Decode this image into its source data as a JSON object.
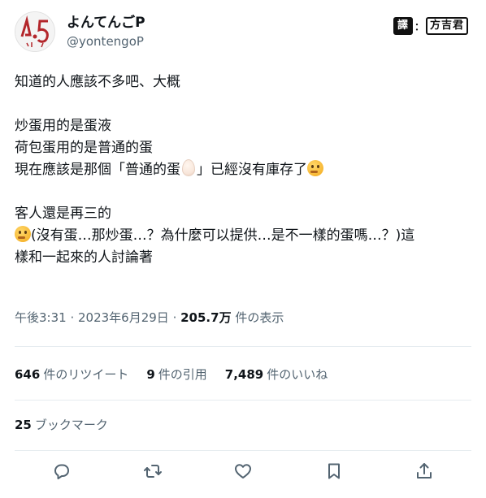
{
  "header": {
    "display_name": "よんてんごP",
    "handle": "@yontengoP",
    "translator_tag_1": "譯",
    "translator_sep": "：",
    "translator_tag_2": "方吉君"
  },
  "tweet": {
    "lines": [
      "知道的人應該不多吧、大概",
      "炒蛋用的是蛋液",
      "荷包蛋用的是普通的蛋",
      "現在應該是那個「普通的蛋",
      "」已經沒有庫存了",
      "客人還是再三的",
      "(沒有蛋…那炒蛋…？為什麼可以提供…是不一樣的蛋嗎…？)這",
      "樣和一起來的人討論著"
    ]
  },
  "meta": {
    "time": "午後3:31",
    "dot1": " · ",
    "date": "2023年6月29日",
    "dot2": " · ",
    "views": "205.7万",
    "views_label": " 件の表示"
  },
  "stats": {
    "retweets_num": "646",
    "retweets_label": "件のリツイート",
    "quotes_num": "9",
    "quotes_label": "件の引用",
    "likes_num": "7,489",
    "likes_label": "件のいいね"
  },
  "bookmarks": {
    "num": "25",
    "label": "ブックマーク"
  },
  "actions": {
    "icons": [
      "reply-icon",
      "retweet-icon",
      "like-icon",
      "bookmark-icon",
      "share-icon"
    ]
  },
  "colors": {
    "text": "#0f1419",
    "secondary": "#536471",
    "divider": "#e6ecf0"
  }
}
